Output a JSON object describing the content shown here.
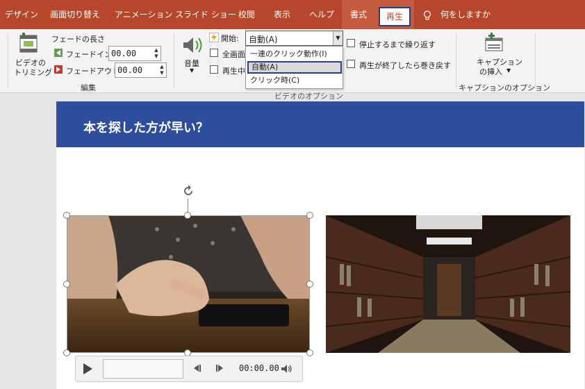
{
  "tabs": [
    {
      "label": "デザイン"
    },
    {
      "label": "画面切り替え"
    },
    {
      "label": "アニメーション"
    },
    {
      "label": "スライド ショー"
    },
    {
      "label": "校閲"
    },
    {
      "label": "表示"
    },
    {
      "label": "ヘルプ"
    },
    {
      "label": "書式"
    },
    {
      "label": "再生"
    }
  ],
  "tell_me": "何をしますか",
  "ribbon": {
    "trim": {
      "label_line1": "ビデオの",
      "label_line2": "トリミング"
    },
    "fade_title": "フェードの長さ",
    "fade_in": {
      "label": "フェードイン:",
      "value": "00.00"
    },
    "fade_out": {
      "label": "フェードアウト:",
      "value": "00.00"
    },
    "edit_group": "編集",
    "volume": {
      "label": "音量"
    },
    "start": {
      "label": "開始:",
      "value": "自動(A)"
    },
    "fullscreen_label": "全画面",
    "hide_label": "再生中",
    "video_options_group": "ビデオのオプション",
    "loop_label": "停止するまで繰り返す",
    "rewind_label": "再生が終了したら巻き戻す",
    "caption": {
      "label_line1": "キャプション",
      "label_line2": "の挿入"
    },
    "caption_group": "キャプションのオプション"
  },
  "dropdown": {
    "options": [
      "一連のクリック動作(I)",
      "自動(A)",
      "クリック時(C)"
    ]
  },
  "slide": {
    "title": "本を探した方が早い？"
  },
  "player": {
    "time": "00:00.00"
  },
  "colors": {
    "accent": "#b7472a",
    "title_bar": "#2c4e9c",
    "highlight_border": "#1f3f8f"
  }
}
